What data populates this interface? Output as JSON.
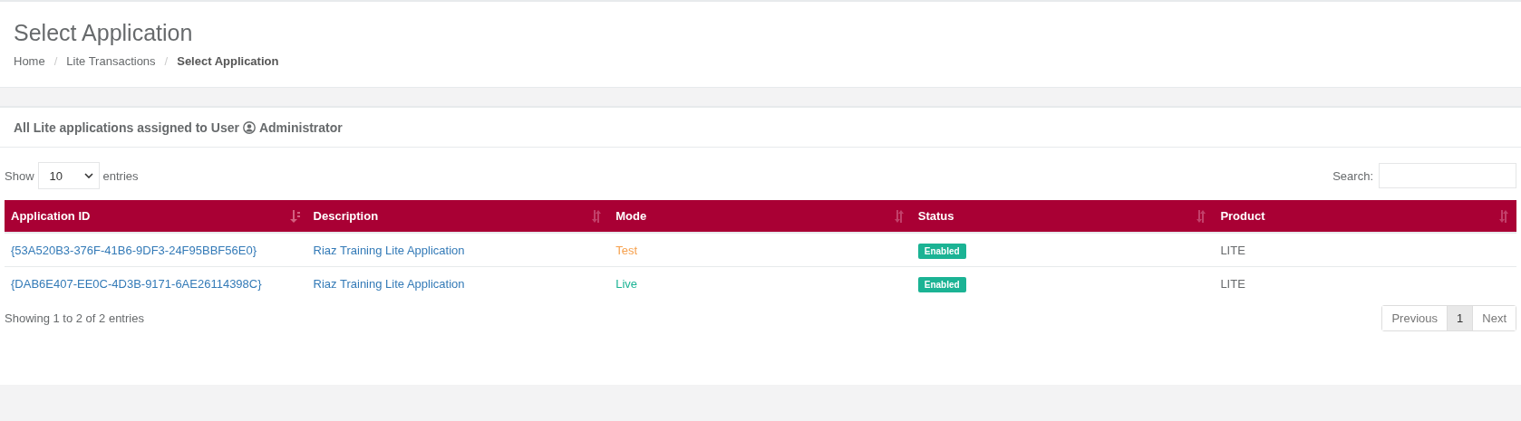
{
  "page_title": "Select Application",
  "breadcrumbs": [
    {
      "kind": "link",
      "label": "Home",
      "current": false
    },
    {
      "kind": "separator",
      "label": "/"
    },
    {
      "kind": "link",
      "label": "Lite Transactions",
      "current": false
    },
    {
      "kind": "separator",
      "label": "/"
    },
    {
      "kind": "link",
      "label": "Select Application",
      "current": true
    }
  ],
  "card_title": {
    "text": "All Lite applications assigned to User",
    "user": "Administrator"
  },
  "length_menu": {
    "label_before": "Show",
    "value": "10",
    "label_after": "entries"
  },
  "search": {
    "label": "Search:"
  },
  "table": {
    "columns": [
      {
        "label": "Application ID",
        "sorted": true
      },
      {
        "label": "Description",
        "sorted": false
      },
      {
        "label": "Mode",
        "sorted": false
      },
      {
        "label": "Status",
        "sorted": false
      },
      {
        "label": "Product",
        "sorted": false
      }
    ],
    "rows": [
      {
        "id": "{53A520B3-376F-41B6-9DF3-24F95BBF56E0}",
        "description": "Riaz Training Lite Application",
        "mode": {
          "text": "Test",
          "color": "#f6a04d"
        },
        "status": "Enabled",
        "product": "LITE"
      },
      {
        "id": "{DAB6E407-EE0C-4D3B-9171-6AE26114398C}",
        "description": "Riaz Training Lite Application",
        "mode": {
          "text": "Live",
          "color": "#1bb394"
        },
        "status": "Enabled",
        "product": "LITE"
      }
    ]
  },
  "info": "Showing 1 to 2 of 2 entries",
  "pagination": [
    {
      "label": "Previous",
      "selected": false
    },
    {
      "label": "1",
      "selected": true
    },
    {
      "label": "Next",
      "selected": false
    }
  ]
}
